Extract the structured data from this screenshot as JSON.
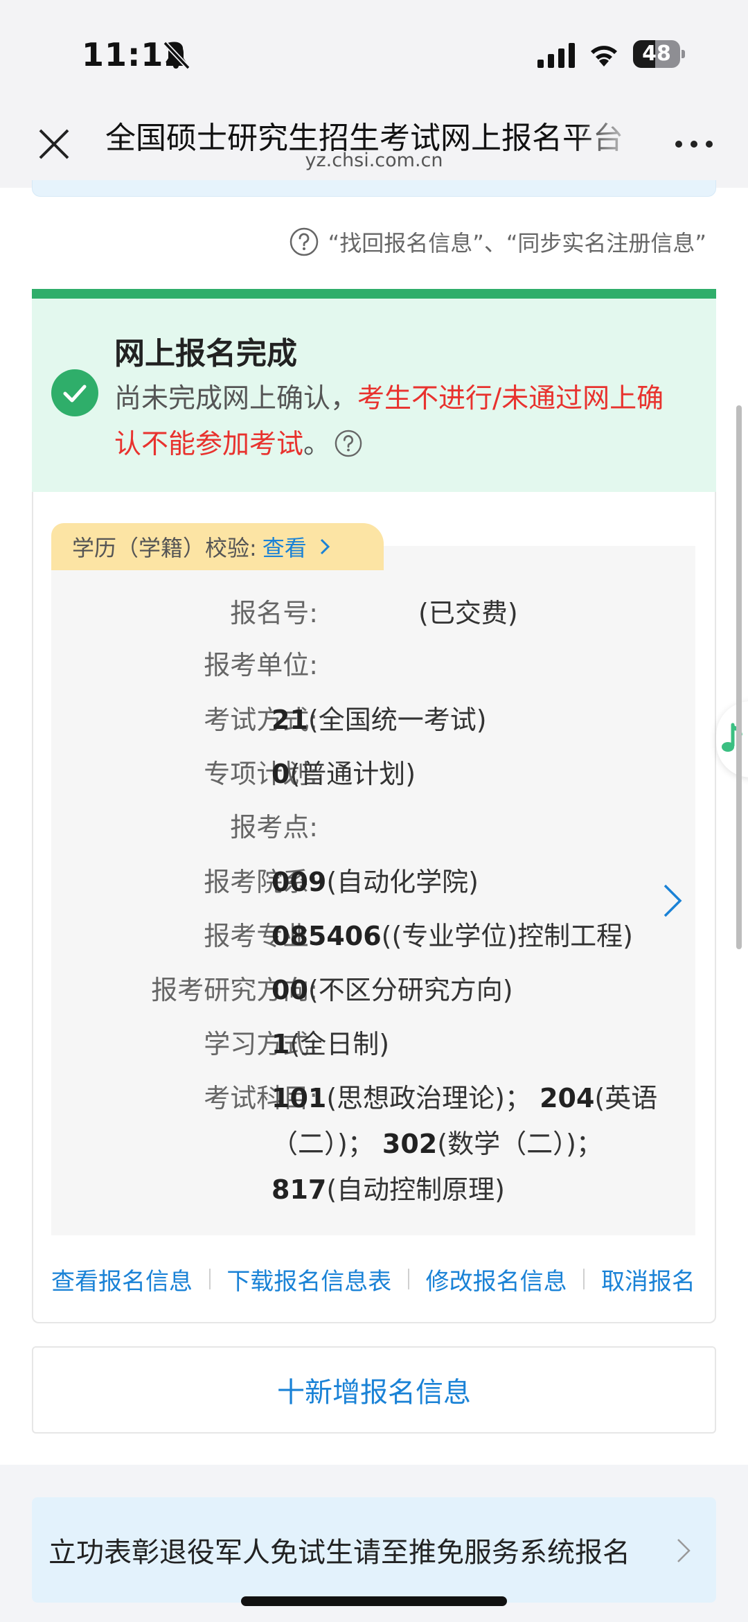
{
  "status_bar": {
    "time": "11:12",
    "battery": "48"
  },
  "nav": {
    "title": "全国硕士研究生招生考试网上报名平台",
    "domain": "yz.chsi.com.cn"
  },
  "help_text": "“找回报名信息”、“同步实名注册信息”",
  "status": {
    "title": "网上报名完成",
    "message_normal": "尚未完成网上确认，",
    "message_red": "考生不进行/未通过网上确认不能参加考试",
    "message_end": "。"
  },
  "verify_tag": {
    "label": "学历（学籍）校验:",
    "link": "查看"
  },
  "fields": {
    "reg_no": {
      "label": "报名号:",
      "value": "(已交费)"
    },
    "unit": {
      "label": "报考单位:",
      "value": ""
    },
    "exam_mode": {
      "label": "考试方式:",
      "code": "21",
      "text": "(全国统一考试)"
    },
    "plan": {
      "label": "专项计划:",
      "code": "0",
      "text": "(普通计划)"
    },
    "site": {
      "label": "报考点:",
      "value": ""
    },
    "dept": {
      "label": "报考院系:",
      "code": "009",
      "text": "(自动化学院)"
    },
    "major": {
      "label": "报考专业:",
      "code": "085406",
      "text": "((专业学位)控制工程)"
    },
    "direction": {
      "label": "报考研究方向:",
      "code": "00",
      "text": "(不区分研究方向)"
    },
    "study_mode": {
      "label": "学习方式:",
      "code": "1",
      "text": "(全日制)"
    },
    "subjects": {
      "label": "考试科目:",
      "s1_code": "101",
      "s1_text": "(思想政治理论)；",
      "s2_code": "204",
      "s2_text": "(英语（二）)；",
      "s3_code": "302",
      "s3_text": "(数学（二）)；",
      "s4_code": "817",
      "s4_text": "(自动控制原理)"
    }
  },
  "actions": {
    "view": "查看报名信息",
    "download": "下载报名信息表",
    "edit": "修改报名信息",
    "cancel": "取消报名"
  },
  "add_label": "十新增报名信息",
  "banner_text": "立功表彰退役军人免试生请至推免服务系统报名",
  "colors": {
    "green": "#2fae6a",
    "red": "#e8322e",
    "link_blue": "#1a82d6",
    "success_bg": "#e3f8ee",
    "tag_bg": "#fce4a4"
  },
  "icons": [
    "bell-slash-icon",
    "signal-icon",
    "wifi-icon",
    "battery-icon",
    "close-icon",
    "more-icon",
    "question-icon",
    "check-circle-icon",
    "chevron-right-icon",
    "music-note-icon"
  ]
}
